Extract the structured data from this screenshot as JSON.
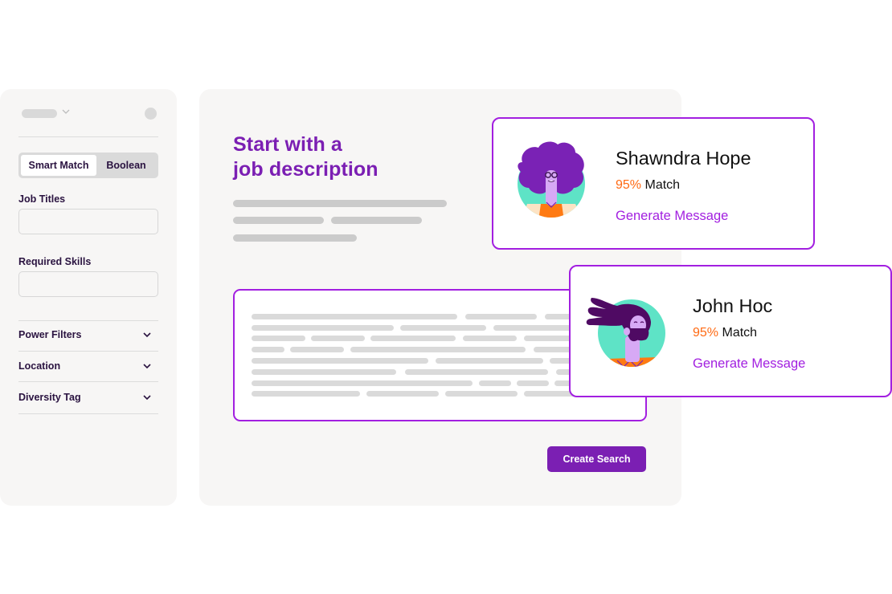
{
  "sidebar": {
    "toggle": {
      "options": [
        "Smart Match",
        "Boolean"
      ],
      "selected": "Smart Match"
    },
    "fields": [
      {
        "label": "Job Titles",
        "value": "",
        "placeholder": ""
      },
      {
        "label": "Required Skills",
        "value": "",
        "placeholder": ""
      }
    ],
    "filters": [
      {
        "label": "Power Filters",
        "icon": "chevron-down-icon"
      },
      {
        "label": "Location",
        "icon": "chevron-down-icon"
      },
      {
        "label": "Diversity Tag",
        "icon": "chevron-down-icon"
      }
    ]
  },
  "main": {
    "headline_line1": "Start with a",
    "headline_line2": "job description",
    "job_description": {
      "value": ""
    },
    "create_button": "Create Search"
  },
  "candidates": [
    {
      "name": "Shawndra Hope",
      "match_pct": "95%",
      "match_label": "Match",
      "action": "Generate Message",
      "avatar": "woman-afro-glasses-avatar"
    },
    {
      "name": "John Hoc",
      "match_pct": "95%",
      "match_label": "Match",
      "action": "Generate Message",
      "avatar": "man-long-hair-beard-avatar"
    }
  ],
  "colors": {
    "brand_purple": "#7b1fb3",
    "accent_purple": "#a21fe0",
    "match_orange": "#ff6a13",
    "panel_bg": "#f7f6f5",
    "label_dark": "#2a1340"
  }
}
